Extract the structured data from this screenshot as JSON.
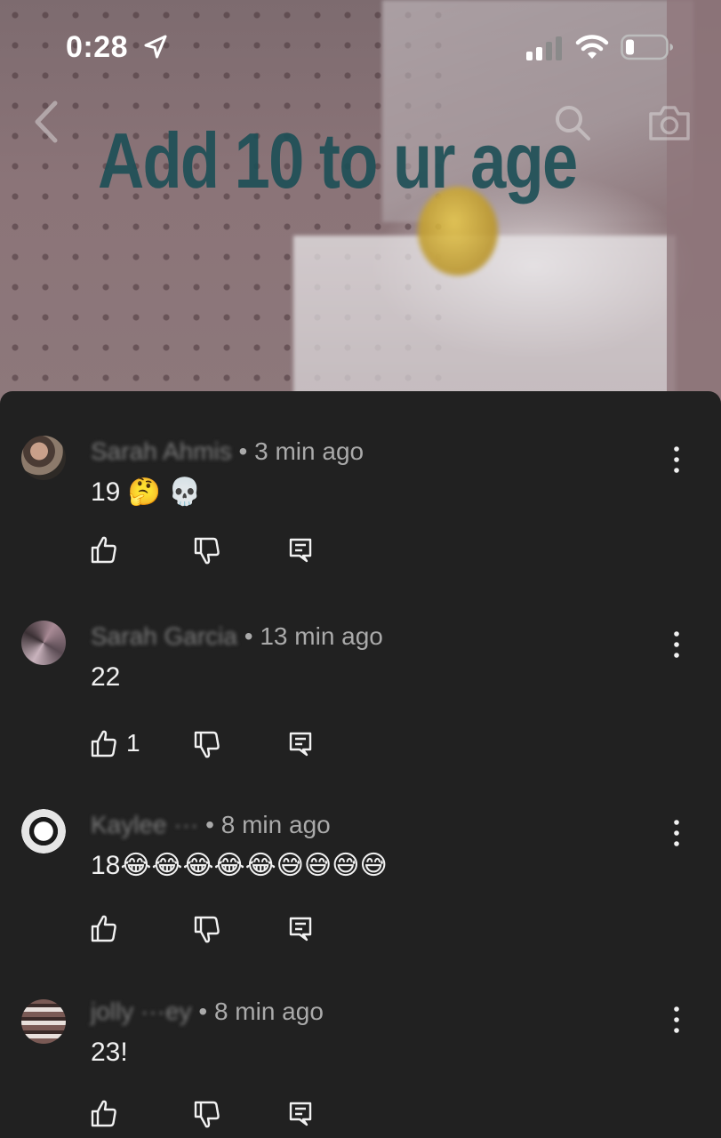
{
  "status_bar": {
    "time": "0:28"
  },
  "video": {
    "overlay_title": "Add 10 to ur age"
  },
  "comments": [
    {
      "author": "Sarah Ahmis",
      "separator": " • ",
      "time": "3 min ago",
      "text": "19 🤔 💀",
      "likes": ""
    },
    {
      "author": "Sarah Garcia",
      "separator": " • ",
      "time": "13 min ago",
      "text": "22",
      "likes": "1"
    },
    {
      "author": "Kaylee ···",
      "separator": " • ",
      "time": "8 min ago",
      "text": "18😂😂😂😂😂😅😅😅😅",
      "likes": ""
    },
    {
      "author": "jolly ···ey",
      "separator": " • ",
      "time": "8 min ago",
      "text": "23!",
      "likes": ""
    }
  ],
  "colors": {
    "sheet_background": "#212121",
    "primary_text": "#f1f1f1",
    "secondary_text": "#aaaaaa",
    "overlay_title": "#1c4f56"
  },
  "icons": [
    "location-arrow-icon",
    "cellular-signal-icon",
    "wifi-icon",
    "battery-icon",
    "back-icon",
    "search-icon",
    "camera-icon",
    "more-vertical-icon",
    "thumbs-up-icon",
    "thumbs-down-icon",
    "reply-icon"
  ]
}
